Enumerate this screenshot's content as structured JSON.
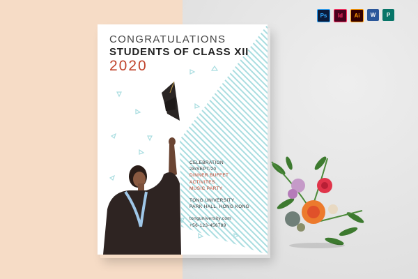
{
  "flyer": {
    "congrats": "CONGRATULATIONS",
    "students": "STUDENTS OF CLASS XII",
    "year": "2020",
    "celebration": "CELEBRATION",
    "date": "28/SEPT/20",
    "events": [
      "DINNER BUFFET",
      "ACTIVITES",
      "MUSIC PARTY"
    ],
    "venue": [
      "TONG UNIVERSITY",
      "PARK HALL, HONG KONG"
    ],
    "website": "tonguniversity.com",
    "phone": "+56-123-456789"
  },
  "app_icons": [
    {
      "name": "photoshop-icon",
      "label": "Ps",
      "color": "#0b1b3a",
      "fg": "#31a8ff"
    },
    {
      "name": "indesign-icon",
      "label": "Id",
      "color": "#49021f",
      "fg": "#ff3366"
    },
    {
      "name": "illustrator-icon",
      "label": "Ai",
      "color": "#330000",
      "fg": "#ff9a00"
    },
    {
      "name": "word-icon",
      "label": "W",
      "color": "#2b579a",
      "fg": "#ffffff"
    },
    {
      "name": "publisher-icon",
      "label": "P",
      "color": "#077568",
      "fg": "#ffffff"
    }
  ],
  "colors": {
    "accent": "#c0432b",
    "stripe": "#a9dde0",
    "paper_bg": "#f6dcc6"
  }
}
